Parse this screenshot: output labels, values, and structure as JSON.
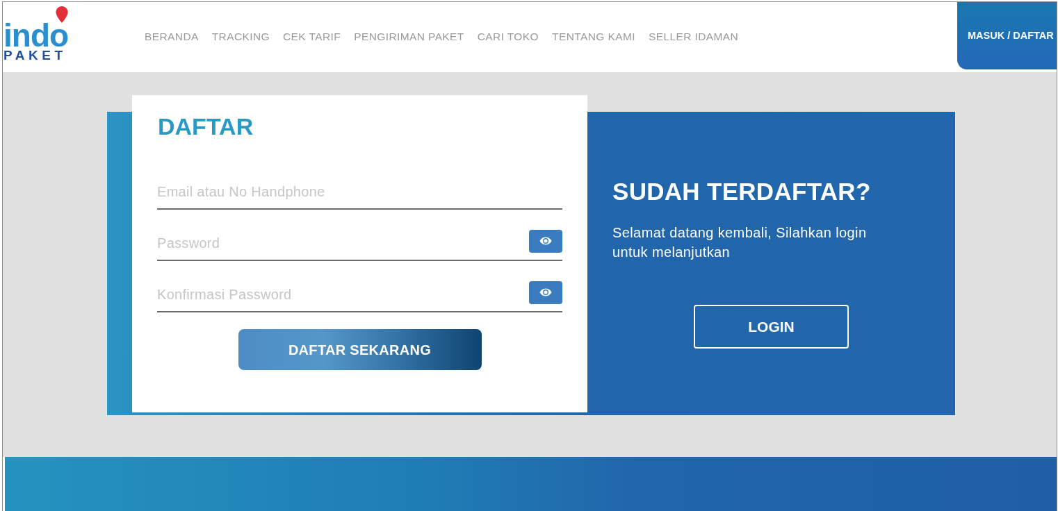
{
  "header": {
    "logo": {
      "word_top": "indo",
      "word_bottom": "PAKET"
    },
    "nav": [
      "BERANDA",
      "TRACKING",
      "CEK TARIF",
      "PENGIRIMAN PAKET",
      "CARI TOKO",
      "TENTANG KAMI",
      "SELLER IDAMAN"
    ],
    "account_button": "MASUK / DAFTAR"
  },
  "register_form": {
    "title": "DAFTAR",
    "fields": [
      {
        "kind": "text",
        "placeholder": "Email atau No Handphone"
      },
      {
        "kind": "password",
        "placeholder": "Password"
      },
      {
        "kind": "password",
        "placeholder": "Konfirmasi Password"
      }
    ],
    "submit_button": "DAFTAR SEKARANG"
  },
  "login_panel": {
    "title": "SUDAH TERDAFTAR?",
    "message": "Selamat datang kembali, Silahkan login untuk melanjutkan",
    "button": "LOGIN"
  }
}
